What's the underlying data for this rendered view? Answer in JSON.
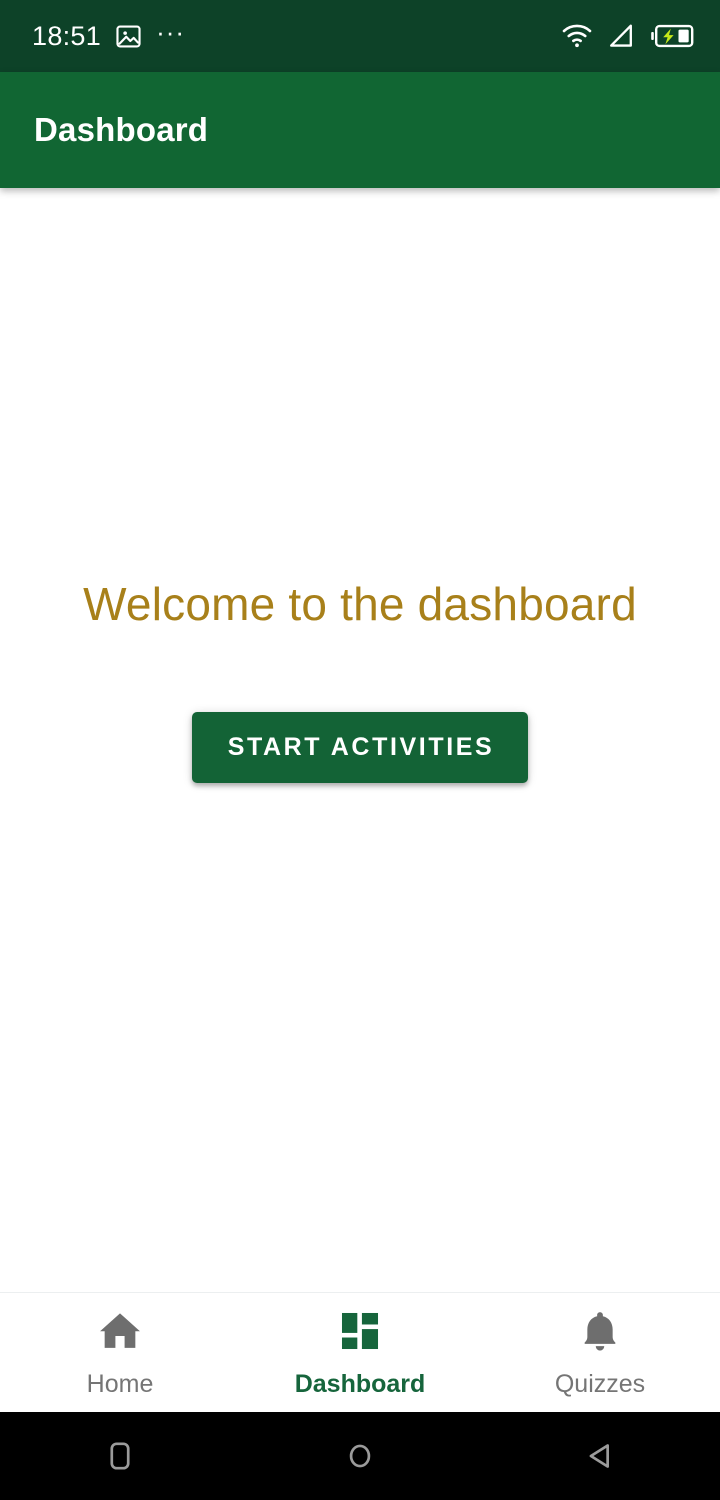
{
  "status_bar": {
    "time": "18:51",
    "left_icons": [
      {
        "name": "image-icon"
      },
      {
        "name": "more-dots-icon",
        "glyph": "···"
      }
    ],
    "right_icons": [
      {
        "name": "wifi-icon"
      },
      {
        "name": "cellular-signal-icon"
      },
      {
        "name": "battery-charging-icon"
      }
    ],
    "background_color": "#0d4228",
    "foreground_color": "#ffffff",
    "battery_bolt_color": "#c6e81a"
  },
  "app_bar": {
    "title": "Dashboard",
    "background_color": "#116633",
    "title_color": "#ffffff"
  },
  "main": {
    "welcome_text": "Welcome to the dashboard",
    "welcome_color": "#a8801a",
    "start_button_label": "START ACTIVITIES",
    "start_button_color": "#136336",
    "start_button_text_color": "#ffffff",
    "background_color": "#ffffff"
  },
  "bottom_nav": {
    "active_color": "#16653c",
    "inactive_color": "#757575",
    "items": [
      {
        "label": "Home",
        "icon": "home-icon",
        "active": false
      },
      {
        "label": "Dashboard",
        "icon": "dashboard-grid-icon",
        "active": true
      },
      {
        "label": "Quizzes",
        "icon": "bell-icon",
        "active": false
      }
    ]
  },
  "system_nav": {
    "background_color": "#000000",
    "icon_color": "#9b9b9b",
    "buttons": [
      {
        "name": "recents-button",
        "shape": "rounded-square"
      },
      {
        "name": "home-button",
        "shape": "circle"
      },
      {
        "name": "back-button",
        "shape": "triangle-left"
      }
    ]
  }
}
